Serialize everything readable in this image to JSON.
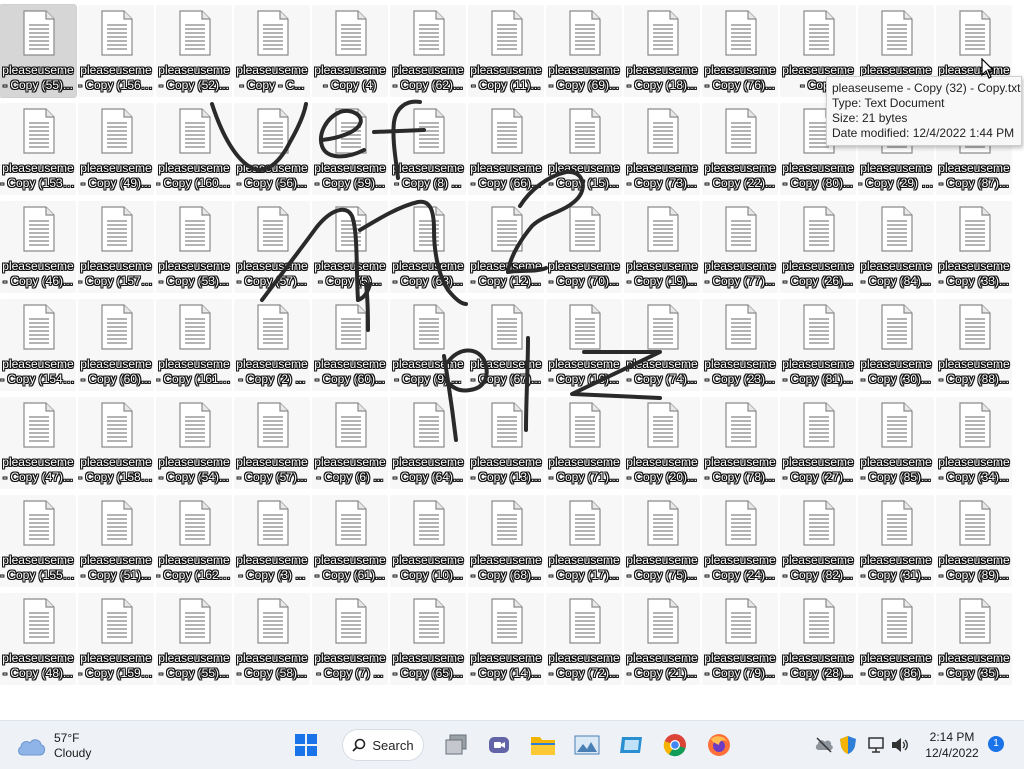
{
  "desktop": {
    "columns": 13,
    "rows": 7,
    "icon_labels": [
      [
        "pleaseuseme - Copy (55)...",
        "pleaseuseme - Copy (156)...",
        "pleaseuseme - Copy (52)...",
        "pleaseuseme - Copy - C...",
        "pleaseuseme - Copy (4)",
        "pleaseuseme - Copy (62)...",
        "pleaseuseme - Copy (11)...",
        "pleaseuseme - Copy (69)...",
        "pleaseuseme - Copy (18)...",
        "pleaseuseme - Copy (76)...",
        "pleaseuseme - Copy",
        "pleaseuseme",
        "pleaseuseme"
      ],
      [
        "pleaseuseme - Copy (153)...",
        "pleaseuseme - Copy (49)...",
        "pleaseuseme - Copy (160)...",
        "pleaseuseme - Copy (56)...",
        "pleaseuseme - Copy (59)...",
        "pleaseuseme - Copy (8) ...",
        "pleaseuseme - Copy (66)...",
        "pleaseuseme - Copy (15)...",
        "pleaseuseme - Copy (73)...",
        "pleaseuseme - Copy (22)...",
        "pleaseuseme - Copy (80)...",
        "pleaseuseme - Copy (29) - Copy.txt",
        "pleaseuseme - Copy (87)..."
      ],
      [
        "pleaseuseme - Copy (46)...",
        "pleaseuseme - Copy (157)...",
        "pleaseuseme - Copy (53)...",
        "pleaseuseme - Copy (57)...",
        "pleaseuseme - Copy (5)...",
        "pleaseuseme - Copy (63)...",
        "pleaseuseme - Copy (12)...",
        "pleaseuseme - Copy (70)...",
        "pleaseuseme - Copy (19)...",
        "pleaseuseme - Copy (77)...",
        "pleaseuseme - Copy (26)...",
        "pleaseuseme - Copy (84)...",
        "pleaseuseme - Copy (33)..."
      ],
      [
        "pleaseuseme - Copy (154)...",
        "pleaseuseme - Copy (60)...",
        "pleaseuseme - Copy (161)...",
        "pleaseuseme - Copy (2) ...",
        "pleaseuseme - Copy (60)...",
        "pleaseuseme - Copy (9) ...",
        "pleaseuseme - Copy (67)...",
        "pleaseuseme - Copy (16)...",
        "pleaseuseme - Copy (74)...",
        "pleaseuseme - Copy (23)...",
        "pleaseuseme - Copy (81)...",
        "pleaseuseme - Copy (30)...",
        "pleaseuseme - Copy (88)..."
      ],
      [
        "pleaseuseme - Copy (47)...",
        "pleaseuseme - Copy (158)...",
        "pleaseuseme - Copy (54)...",
        "pleaseuseme - Copy (57)...",
        "pleaseuseme - Copy (6) ...",
        "pleaseuseme - Copy (64)...",
        "pleaseuseme - Copy (13)...",
        "pleaseuseme - Copy (71)...",
        "pleaseuseme - Copy (20)...",
        "pleaseuseme - Copy (78)...",
        "pleaseuseme - Copy (27)...",
        "pleaseuseme - Copy (85)...",
        "pleaseuseme - Copy (34)..."
      ],
      [
        "pleaseuseme - Copy (155)...",
        "pleaseuseme - Copy (51)...",
        "pleaseuseme - Copy (162)...",
        "pleaseuseme - Copy (3) ...",
        "pleaseuseme - Copy (61)...",
        "pleaseuseme - Copy (10)...",
        "pleaseuseme - Copy (68)...",
        "pleaseuseme - Copy (17)...",
        "pleaseuseme - Copy (75)...",
        "pleaseuseme - Copy (24)...",
        "pleaseuseme - Copy (82)...",
        "pleaseuseme - Copy (31)...",
        "pleaseuseme - Copy (89)..."
      ],
      [
        "pleaseuseme - Copy (48)...",
        "pleaseuseme - Copy (159)...",
        "pleaseuseme - Copy (55)...",
        "pleaseuseme - Copy (58)...",
        "pleaseuseme - Copy (7) ...",
        "pleaseuseme - Copy (65)...",
        "pleaseuseme - Copy (14)...",
        "pleaseuseme - Copy (72)...",
        "pleaseuseme - Copy (21)...",
        "pleaseuseme - Copy (79)...",
        "pleaseuseme - Copy (28)...",
        "pleaseuseme - Copy (86)...",
        "pleaseuseme - Copy (35)..."
      ]
    ]
  },
  "tooltip": {
    "name": "pleaseuseme - Copy (32) - Copy.txt",
    "type": "Type: Text Document",
    "size": "Size: 21 bytes",
    "modified": "Date modified: 12/4/2022 1:44 PM"
  },
  "taskbar": {
    "weather_temp": "57°F",
    "weather_cond": "Cloudy",
    "search_label": "Search",
    "start_icon": "windows-start-icon",
    "pinned_icons": [
      "task-view-icon",
      "teams-chat-icon",
      "file-explorer-icon",
      "photos-icon",
      "tablet-app-icon",
      "chrome-icon",
      "firefox-icon"
    ],
    "tray_icons": [
      "cloud-offline-icon",
      "security-shield-icon",
      "network-icon",
      "volume-icon"
    ],
    "time": "2:14 PM",
    "date": "12/4/2022",
    "notification_count": "1"
  },
  "colors": {
    "taskbar_bg": "#eef2f7",
    "start_blue": "#1a73e8",
    "folder_yellow": "#f4b400",
    "scribble": "#2a2a2a"
  }
}
